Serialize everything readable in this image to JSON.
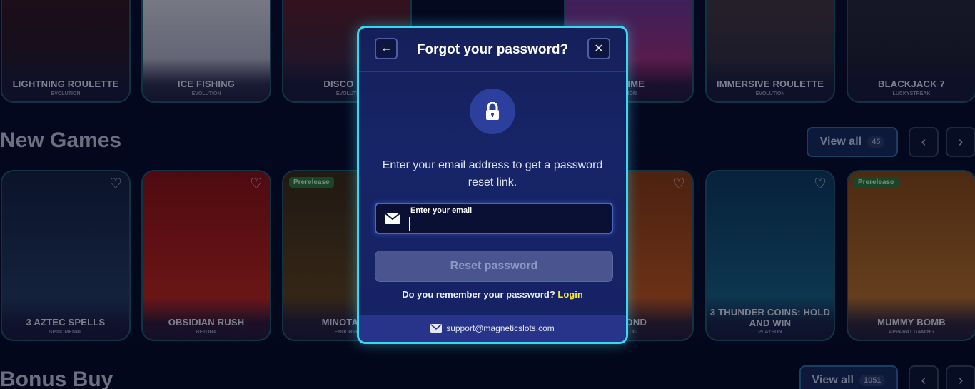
{
  "top_row": [
    {
      "title": "LIGHTNING ROULETTE",
      "provider": "EVOLUTION"
    },
    {
      "title": "ICE FISHING",
      "provider": "EVOLUTION"
    },
    {
      "title": "DISCO BA",
      "provider": "EVOLUTI"
    },
    {
      "title": "Y TIME",
      "provider": "UTION"
    },
    {
      "title": "IMMERSIVE ROULETTE",
      "provider": "EVOLUTION"
    },
    {
      "title": "BLACKJACK 7",
      "provider": "LUCKYSTREAK"
    }
  ],
  "new_games": {
    "heading": "New Games",
    "view_all_label": "View all",
    "view_all_count": "45",
    "prev_icon": "chevron-left-icon",
    "next_icon": "chevron-right-icon",
    "cards": [
      {
        "title": "3 AZTEC SPELLS",
        "provider": "SPINOMENAL",
        "badge": "",
        "colors": [
          "#1b2b4a",
          "#2e4a6e"
        ]
      },
      {
        "title": "OBSIDIAN RUSH",
        "provider": "BETORA",
        "badge": "",
        "colors": [
          "#7a0d0d",
          "#c01e1e"
        ]
      },
      {
        "title": "MINOTAUR",
        "provider": "ENDORPH",
        "badge": "Prerelease",
        "colors": [
          "#3a2a12",
          "#6b4a1c"
        ]
      },
      {
        "title": "AMOND",
        "provider": "MATIC",
        "badge": "",
        "colors": [
          "#8a3a0e",
          "#d4601c"
        ]
      },
      {
        "title": "3 THUNDER COINS: HOLD AND WIN",
        "provider": "PLAYSON",
        "badge": "",
        "colors": [
          "#0c3a5c",
          "#1a6b8c"
        ]
      },
      {
        "title": "MUMMY BOMB",
        "provider": "APPARAT GAMING",
        "badge": "Prerelease",
        "colors": [
          "#8a4a12",
          "#c57a2c"
        ]
      }
    ]
  },
  "bonus_buy": {
    "heading": "Bonus Buy",
    "view_all_label": "View all",
    "view_all_count": "1051"
  },
  "modal": {
    "title": "Forgot your password?",
    "back_icon": "arrow-left-icon",
    "close_icon": "close-icon",
    "lock_icon": "lock-icon",
    "description": "Enter your email address to get a password reset link.",
    "email_label": "Enter your email",
    "email_value": "",
    "email_placeholder": "",
    "reset_label": "Reset password",
    "remember_text": "Do you remember your password?",
    "login_label": "Login",
    "support_icon": "envelope-icon",
    "support_email": "support@magneticslots.com"
  },
  "colors": {
    "accent": "#39d8f0",
    "login_link": "#f5e93a",
    "modal_bg": "#172467"
  }
}
